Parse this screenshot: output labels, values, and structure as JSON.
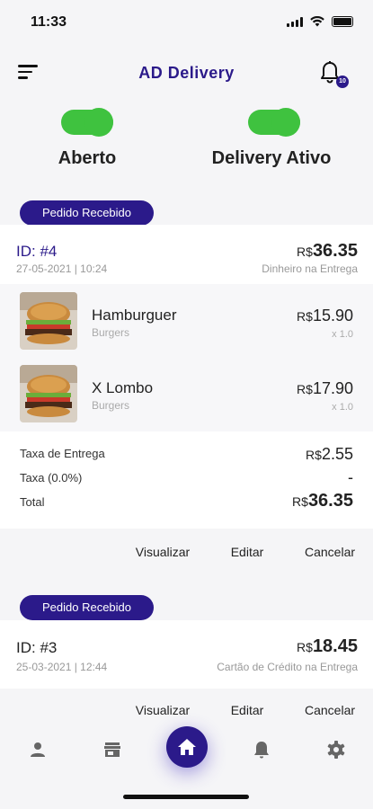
{
  "status_bar": {
    "time": "11:33"
  },
  "header": {
    "title": "AD Delivery",
    "notification_count": "10"
  },
  "toggles": [
    {
      "label": "Aberto",
      "on": true
    },
    {
      "label": "Delivery Ativo",
      "on": true
    }
  ],
  "orders": [
    {
      "status": "Pedido Recebido",
      "id": "ID: #4",
      "date": "27-05-2021 | 10:24",
      "currency": "R$",
      "total": "36.35",
      "payment": "Dinheiro na Entrega",
      "items": [
        {
          "name": "Hamburguer",
          "category": "Burgers",
          "price": "15.90",
          "qty": "x 1.0"
        },
        {
          "name": "X Lombo",
          "category": "Burgers",
          "price": "17.90",
          "qty": "x 1.0"
        }
      ],
      "summary": {
        "delivery_fee_label": "Taxa de Entrega",
        "delivery_fee": "2.55",
        "tax_label": "Taxa (0.0%)",
        "tax": "-",
        "total_label": "Total",
        "total": "36.35"
      },
      "actions": {
        "view": "Visualizar",
        "edit": "Editar",
        "cancel": "Cancelar"
      }
    },
    {
      "status": "Pedido Recebido",
      "id": "ID: #3",
      "date": "25-03-2021 | 12:44",
      "currency": "R$",
      "total": "18.45",
      "payment": "Cartão de Crédito na Entrega",
      "actions": {
        "view": "Visualizar",
        "edit": "Editar",
        "cancel": "Cancelar"
      }
    }
  ],
  "bottom_nav": [
    {
      "icon": "user-icon"
    },
    {
      "icon": "store-icon"
    },
    {
      "icon": "home-icon",
      "active": true
    },
    {
      "icon": "bell-icon"
    },
    {
      "icon": "gear-icon"
    }
  ],
  "colors": {
    "primary": "#2b1a8a",
    "toggle_on": "#3fc23f"
  }
}
